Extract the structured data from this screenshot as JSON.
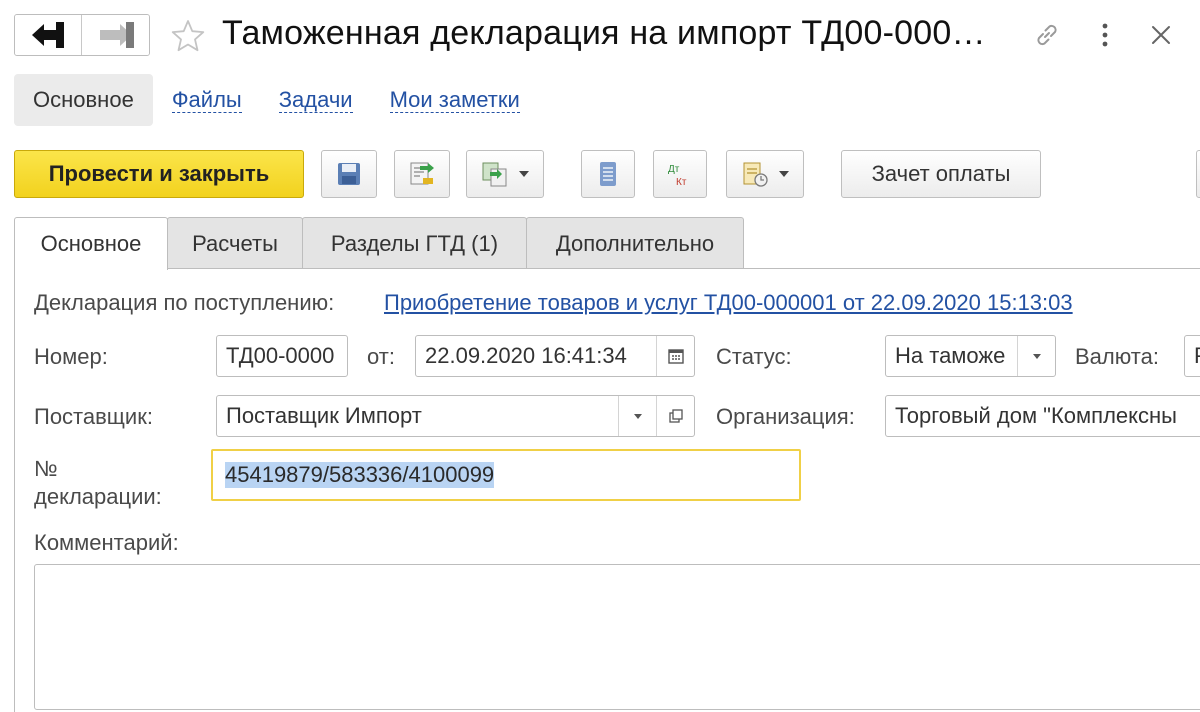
{
  "window": {
    "title": "Таможенная декларация на импорт ТД00-000…"
  },
  "icons": {
    "back": "arrow-left-icon",
    "forward": "arrow-right-icon",
    "favorite": "star-outline-icon",
    "link": "link-icon",
    "more": "more-vertical-icon",
    "close": "close-icon"
  },
  "section_nav": {
    "active": "Основное",
    "links": [
      "Файлы",
      "Задачи",
      "Мои заметки"
    ]
  },
  "toolbar": {
    "post_close_label": "Провести и закрыть",
    "payment_offset_label": "Зачет оплаты"
  },
  "tabs": [
    {
      "label": "Основное",
      "active": true
    },
    {
      "label": "Расчеты",
      "active": false
    },
    {
      "label": "Разделы ГТД (1)",
      "active": false
    },
    {
      "label": "Дополнительно",
      "active": false
    }
  ],
  "form": {
    "receipt_label": "Декларация по поступлению:",
    "receipt_link": "Приобретение товаров и услуг ТД00-000001 от 22.09.2020 15:13:03",
    "number_label": "Номер:",
    "number_value": "ТД00-0000",
    "date_label": "от:",
    "date_value": "22.09.2020 16:41:34",
    "status_label": "Статус:",
    "status_value": "На таможе",
    "currency_label": "Валюта:",
    "currency_value": "Р",
    "supplier_label": "Поставщик:",
    "supplier_value": "Поставщик Импорт",
    "org_label": "Организация:",
    "org_value": "Торговый дом \"Комплексны",
    "decl_label_line1": "№",
    "decl_label_line2": "декларации:",
    "decl_value": "45419879/583336/4100099",
    "comment_label": "Комментарий:",
    "comment_value": ""
  },
  "colors": {
    "primary_button": "#f2d21e",
    "link": "#2351a3",
    "focus_border": "#f0d046",
    "selection": "#b9d4f3"
  }
}
